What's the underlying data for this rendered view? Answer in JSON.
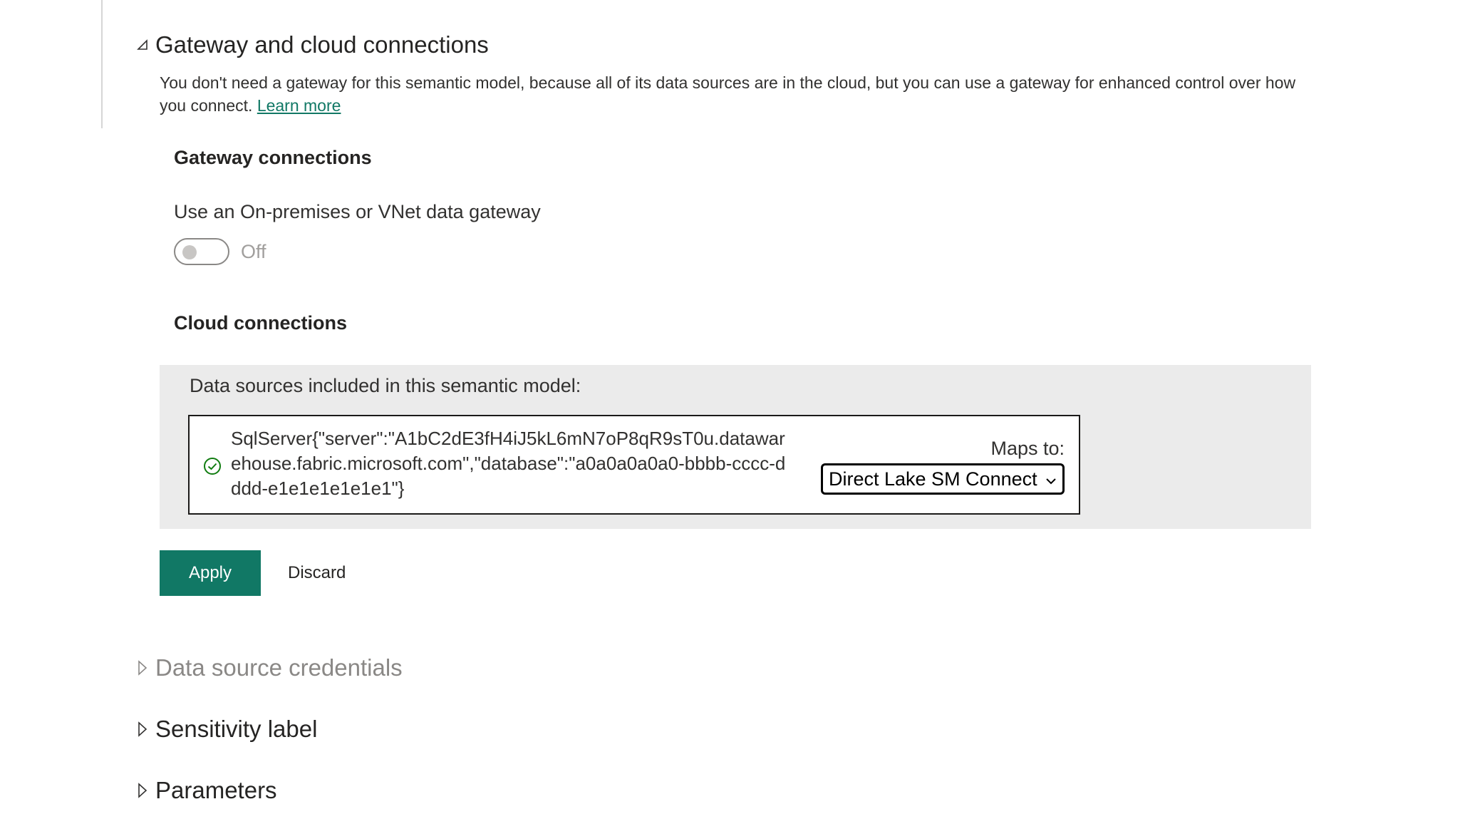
{
  "gateway_section": {
    "title": "Gateway and cloud connections",
    "description": "You don't need a gateway for this semantic model, because all of its data sources are in the cloud, but you can use a gateway for enhanced control over how you connect.",
    "learn_more": "Learn more",
    "expanded": true
  },
  "gateway_connections": {
    "heading": "Gateway connections",
    "toggle_label": "Use an On-premises or VNet data gateway",
    "toggle_state": "Off",
    "toggle_on": false
  },
  "cloud_connections": {
    "heading": "Cloud connections",
    "panel_caption": "Data sources included in this semantic model:",
    "data_source": {
      "status_icon": "check-circle-icon",
      "text": "SqlServer{\"server\":\"A1bC2dE3fH4iJ5kL6mN7oP8qR9sT0u.datawarehouse.fabric.microsoft.com\",\"database\":\"a0a0a0a0a0-bbbb-cccc-dddd-e1e1e1e1e1e1\"}",
      "maps_to_label": "Maps to:",
      "maps_to_value": "Direct Lake SM Connect"
    }
  },
  "actions": {
    "apply": "Apply",
    "discard": "Discard"
  },
  "collapsed_sections": {
    "credentials": "Data source credentials",
    "sensitivity": "Sensitivity label",
    "parameters": "Parameters"
  },
  "colors": {
    "accent": "#117865",
    "panel_bg": "#ebebeb",
    "success": "#107c10",
    "muted_text": "#8a8886"
  }
}
